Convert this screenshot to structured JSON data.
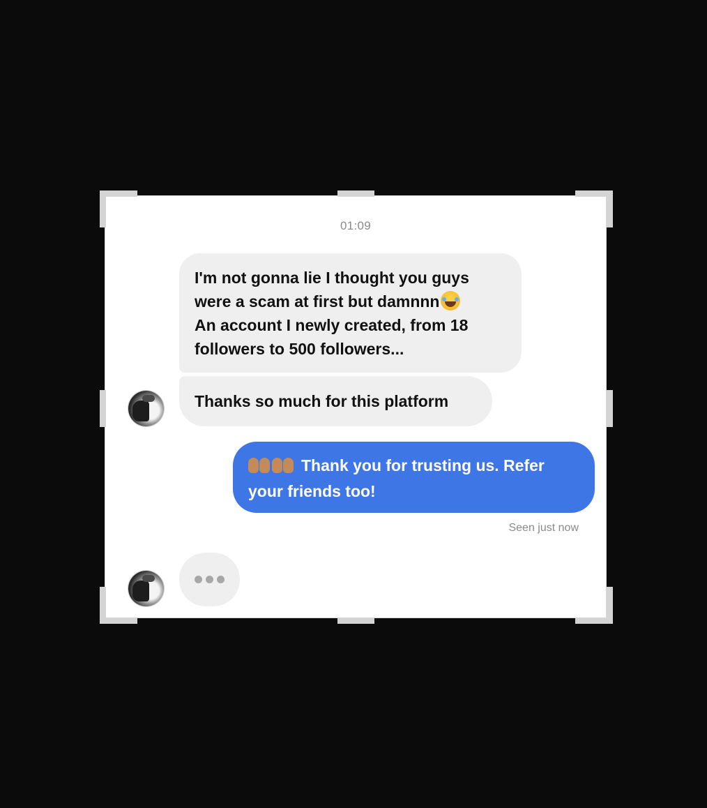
{
  "chat": {
    "timestamp": "01:09",
    "incoming_message_1": {
      "lines": [
        "I'm not gonna lie I thought you guys",
        "were a scam at first but damnnn",
        "An account I newly created, from 18",
        "followers to 500 followers..."
      ],
      "emoji": "face-with-tears-of-joy"
    },
    "incoming_message_2": "Thanks so much for this platform",
    "outgoing_message": {
      "emoji": "palms-up-together x2",
      "lines": [
        "Thank you for trusting us. Refer",
        "your friends too!"
      ]
    },
    "seen_status": "Seen just now",
    "typing_indicator": "typing-dots"
  },
  "colors": {
    "background": "#0b0b0b",
    "card": "#ffffff",
    "incoming_bubble": "#efefef",
    "outgoing_bubble": "#3f76e6",
    "crop_handle": "#d4d4d4",
    "meta_text": "#8a8a8a"
  }
}
